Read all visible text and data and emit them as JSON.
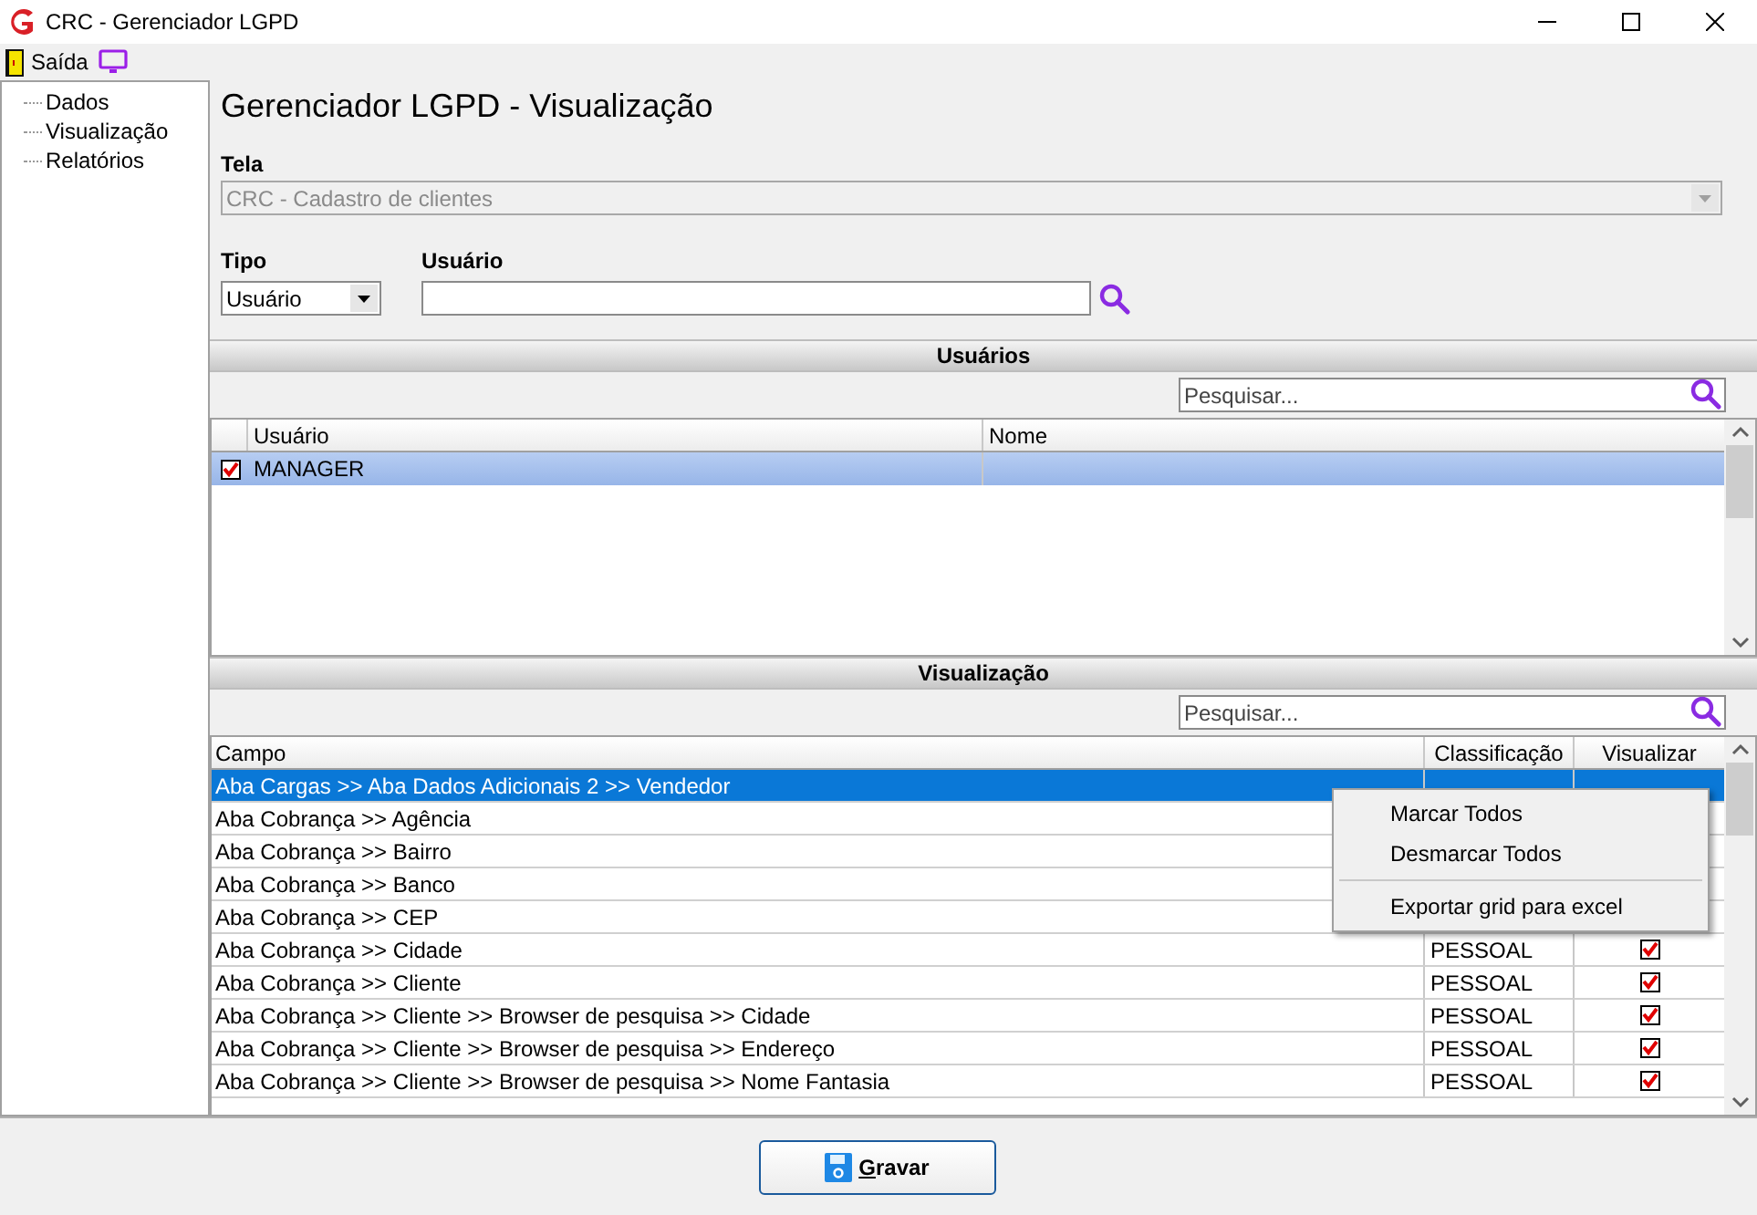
{
  "window": {
    "title": "CRC - Gerenciador LGPD"
  },
  "toolbar": {
    "exit_label": "Saída"
  },
  "sidebar": {
    "items": [
      {
        "label": "Dados"
      },
      {
        "label": "Visualização"
      },
      {
        "label": "Relatórios"
      }
    ]
  },
  "heading": "Gerenciador LGPD - Visualização",
  "tela": {
    "label": "Tela",
    "value": "CRC - Cadastro de clientes",
    "disabled": true
  },
  "tipo": {
    "label": "Tipo",
    "value": "Usuário"
  },
  "usuario": {
    "label": "Usuário"
  },
  "users_section": {
    "title": "Usuários",
    "search_placeholder": "Pesquisar...",
    "columns": [
      "Usuário",
      "Nome"
    ],
    "rows": [
      {
        "usuario": "MANAGER",
        "nome": "",
        "checked": true,
        "selected": true
      }
    ]
  },
  "view_section": {
    "title": "Visualização",
    "search_placeholder": "Pesquisar...",
    "columns": [
      "Campo",
      "Classificação",
      "Visualizar"
    ],
    "rows": [
      {
        "campo": "Aba Cargas >> Aba Dados Adicionais 2 >> Vendedor",
        "selected": true
      },
      {
        "campo": "Aba Cobrança >> Agência",
        "selected": false
      },
      {
        "campo": "Aba Cobrança >> Bairro",
        "selected": false
      },
      {
        "campo": "Aba Cobrança >> Banco",
        "selected": false
      },
      {
        "campo": "Aba Cobrança >> CEP",
        "selected": false
      },
      {
        "campo": "Aba Cobrança >> Cidade",
        "classificacao": "PESSOAL",
        "checked": true,
        "selected": false
      },
      {
        "campo": "Aba Cobrança >> Cliente",
        "classificacao": "PESSOAL",
        "checked": true,
        "selected": false
      },
      {
        "campo": "Aba Cobrança >> Cliente >> Browser de pesquisa >> Cidade",
        "classificacao": "PESSOAL",
        "checked": true,
        "selected": false
      },
      {
        "campo": "Aba Cobrança >> Cliente >> Browser de pesquisa >> Endereço",
        "classificacao": "PESSOAL",
        "checked": true,
        "selected": false
      },
      {
        "campo": "Aba Cobrança >> Cliente >> Browser de pesquisa >> Nome Fantasia",
        "classificacao": "PESSOAL",
        "checked": true,
        "selected": false
      }
    ]
  },
  "context_menu": {
    "items": [
      {
        "label": "Marcar Todos",
        "kind": "item"
      },
      {
        "label": "Desmarcar Todos",
        "kind": "item"
      },
      {
        "kind": "separator"
      },
      {
        "label": "Exportar grid para excel",
        "kind": "item"
      }
    ]
  },
  "save_button": {
    "label": "Gravar"
  }
}
